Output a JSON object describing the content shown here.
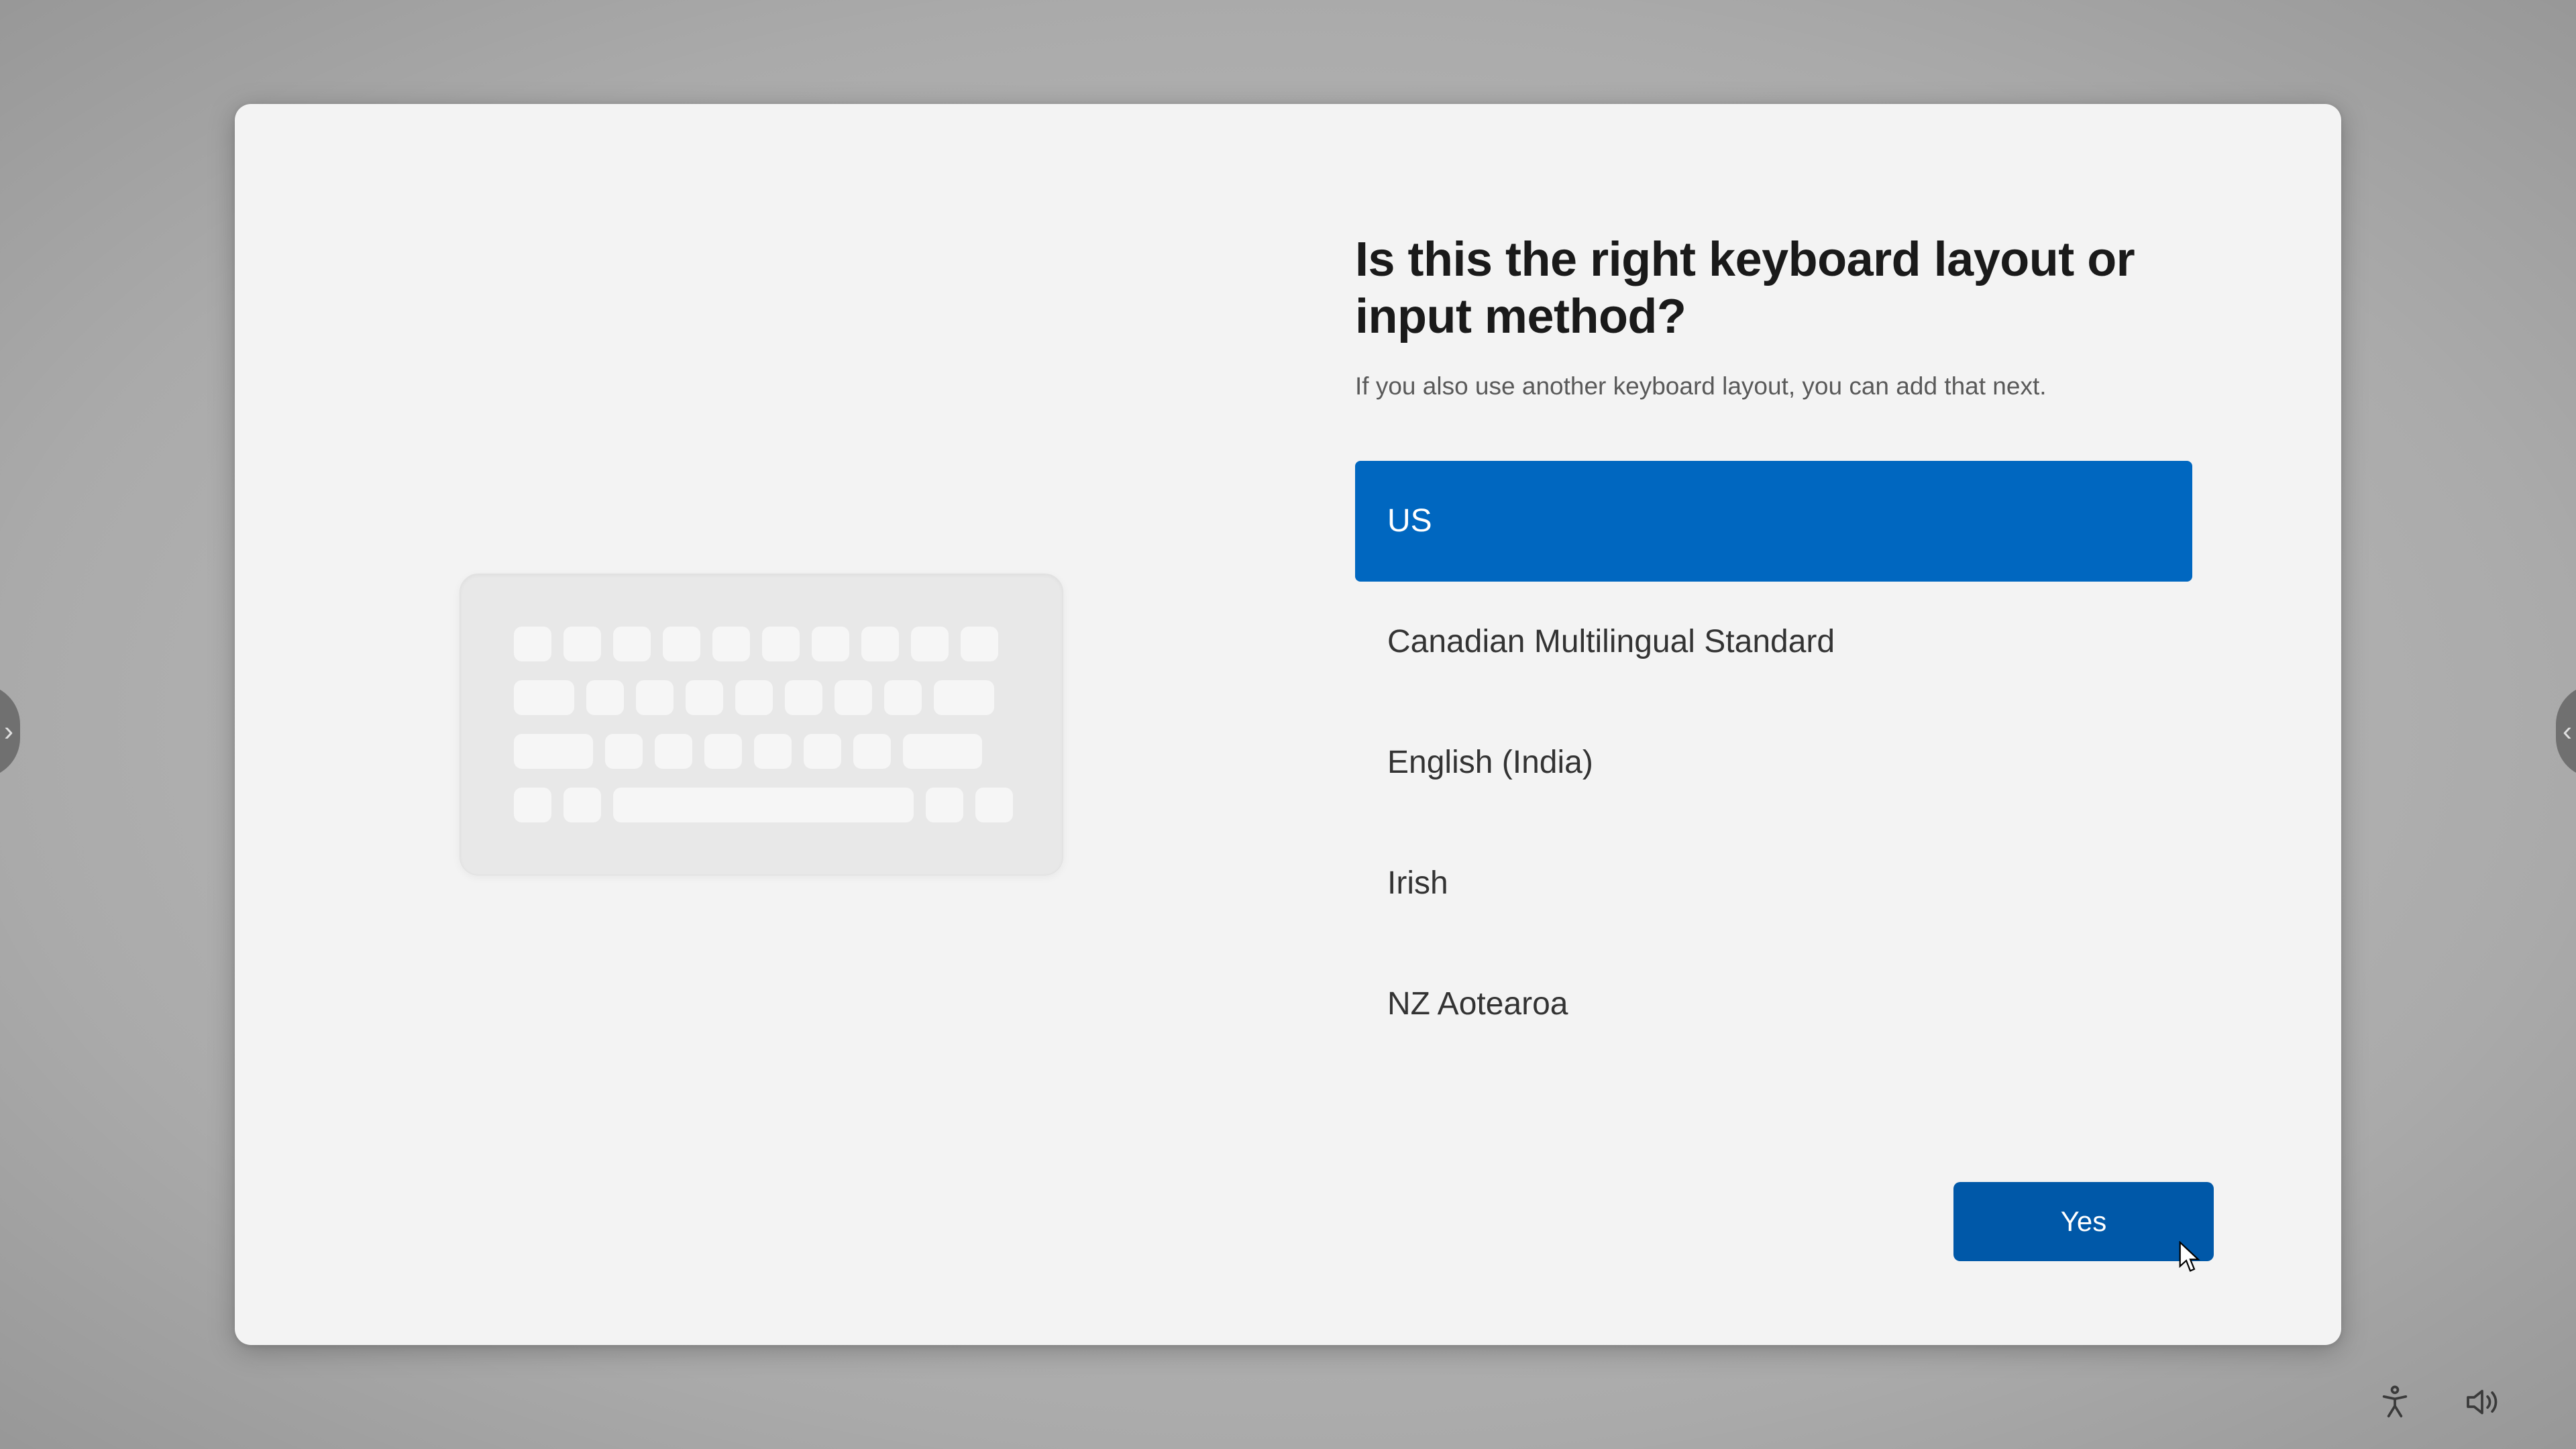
{
  "heading": "Is this the right keyboard layout or input method?",
  "subheading": "If you also use another keyboard layout, you can add that next.",
  "layouts": {
    "items": [
      {
        "label": "US",
        "selected": true
      },
      {
        "label": "Canadian Multilingual Standard",
        "selected": false
      },
      {
        "label": "English (India)",
        "selected": false
      },
      {
        "label": "Irish",
        "selected": false
      },
      {
        "label": "NZ Aotearoa",
        "selected": false
      }
    ]
  },
  "buttons": {
    "yes": "Yes"
  },
  "icons": {
    "accessibility": "accessibility-icon",
    "volume": "volume-icon"
  },
  "colors": {
    "accent": "#0067C0",
    "accent_dark": "#0058a8"
  }
}
